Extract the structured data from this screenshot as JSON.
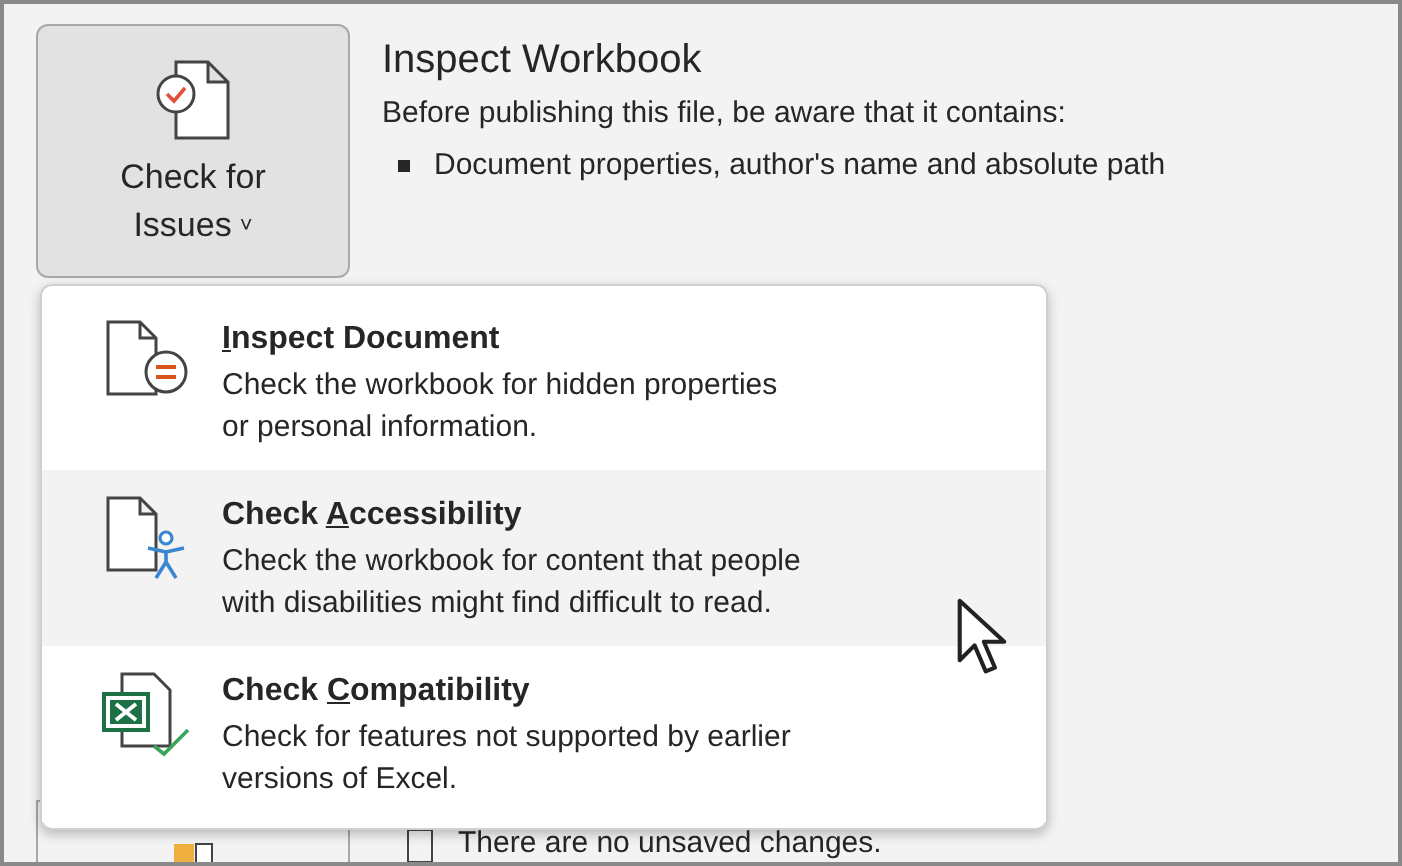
{
  "check_button": {
    "label_line1": "Check for",
    "label_line2": "Issues",
    "caret": "˅"
  },
  "inspect": {
    "title": "Inspect Workbook",
    "intro": "Before publishing this file, be aware that it contains:",
    "bullets": [
      "Document properties, author's name and absolute path"
    ]
  },
  "menu": {
    "items": [
      {
        "kind": "inspect",
        "access_key": "I",
        "title_after": "nspect Document",
        "description": "Check the workbook for hidden properties or personal information.",
        "highlighted": false
      },
      {
        "kind": "accessibility",
        "title_before": "Check ",
        "access_key": "A",
        "title_after": "ccessibility",
        "description": "Check the workbook for content that people with disabilities might find difficult to read.",
        "highlighted": true
      },
      {
        "kind": "compatibility",
        "title_before": "Check ",
        "access_key": "C",
        "title_after": "ompatibility",
        "description": "Check for features not supported by earlier versions of Excel.",
        "highlighted": false
      }
    ]
  },
  "versions": {
    "status": "There are no unsaved changes."
  }
}
